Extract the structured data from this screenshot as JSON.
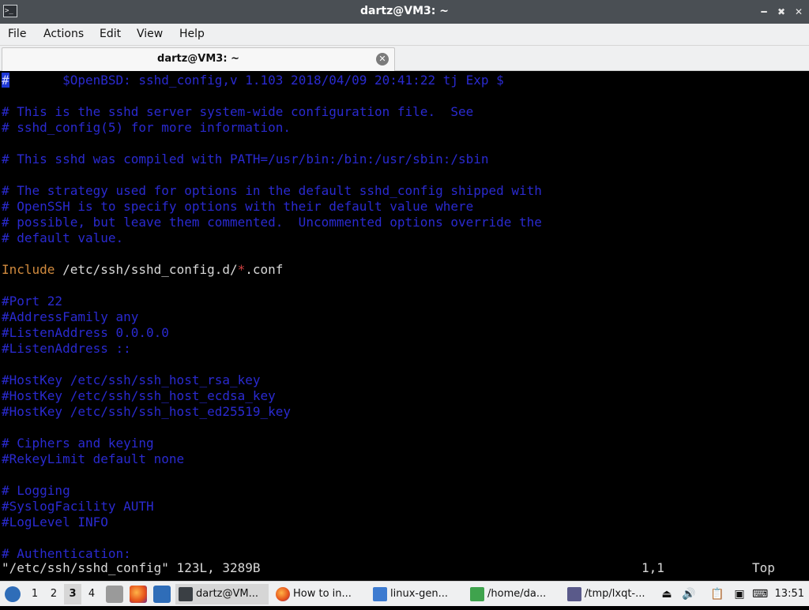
{
  "window": {
    "title": "dartz@VM3: ~",
    "app_icon": "terminal-icon",
    "buttons": [
      "minimize-icon",
      "maximize-icon",
      "close-icon"
    ]
  },
  "menu": [
    "File",
    "Actions",
    "Edit",
    "View",
    "Help"
  ],
  "tab": {
    "label": "dartz@VM3: ~"
  },
  "terminal": {
    "lines": [
      {
        "parts": [
          [
            "cursor",
            "#"
          ],
          [
            "c",
            "       $OpenBSD: sshd_config,v 1.103 2018/04/09 20:41:22 tj Exp $"
          ]
        ]
      },
      {
        "parts": []
      },
      {
        "parts": [
          [
            "c",
            "# This is the sshd server system-wide configuration file.  See"
          ]
        ]
      },
      {
        "parts": [
          [
            "c",
            "# sshd_config(5) for more information."
          ]
        ]
      },
      {
        "parts": []
      },
      {
        "parts": [
          [
            "c",
            "# This sshd was compiled with PATH=/usr/bin:/bin:/usr/sbin:/sbin"
          ]
        ]
      },
      {
        "parts": []
      },
      {
        "parts": [
          [
            "c",
            "# The strategy used for options in the default sshd_config shipped with"
          ]
        ]
      },
      {
        "parts": [
          [
            "c",
            "# OpenSSH is to specify options with their default value where"
          ]
        ]
      },
      {
        "parts": [
          [
            "c",
            "# possible, but leave them commented.  Uncommented options override the"
          ]
        ]
      },
      {
        "parts": [
          [
            "c",
            "# default value."
          ]
        ]
      },
      {
        "parts": []
      },
      {
        "parts": [
          [
            "k",
            "Include"
          ],
          [
            "n",
            " /etc/ssh/sshd_config.d/"
          ],
          [
            "s",
            "*"
          ],
          [
            "n",
            ".conf"
          ]
        ]
      },
      {
        "parts": []
      },
      {
        "parts": [
          [
            "c",
            "#Port 22"
          ]
        ]
      },
      {
        "parts": [
          [
            "c",
            "#AddressFamily any"
          ]
        ]
      },
      {
        "parts": [
          [
            "c",
            "#ListenAddress 0.0.0.0"
          ]
        ]
      },
      {
        "parts": [
          [
            "c",
            "#ListenAddress ::"
          ]
        ]
      },
      {
        "parts": []
      },
      {
        "parts": [
          [
            "c",
            "#HostKey /etc/ssh/ssh_host_rsa_key"
          ]
        ]
      },
      {
        "parts": [
          [
            "c",
            "#HostKey /etc/ssh/ssh_host_ecdsa_key"
          ]
        ]
      },
      {
        "parts": [
          [
            "c",
            "#HostKey /etc/ssh/ssh_host_ed25519_key"
          ]
        ]
      },
      {
        "parts": []
      },
      {
        "parts": [
          [
            "c",
            "# Ciphers and keying"
          ]
        ]
      },
      {
        "parts": [
          [
            "c",
            "#RekeyLimit default none"
          ]
        ]
      },
      {
        "parts": []
      },
      {
        "parts": [
          [
            "c",
            "# Logging"
          ]
        ]
      },
      {
        "parts": [
          [
            "c",
            "#SyslogFacility AUTH"
          ]
        ]
      },
      {
        "parts": [
          [
            "c",
            "#LogLevel INFO"
          ]
        ]
      },
      {
        "parts": []
      },
      {
        "parts": [
          [
            "c",
            "# Authentication:"
          ]
        ]
      }
    ],
    "status_file": "\"/etc/ssh/sshd_config\" 123L, 3289B",
    "status_pos": "1,1",
    "status_scroll": "Top"
  },
  "taskbar": {
    "menu_icon": "lxqt-menu-icon",
    "desktops": [
      "1",
      "2",
      "3",
      "4"
    ],
    "active_desktop": "3",
    "launchers": [
      "file-manager-icon",
      "firefox-icon",
      "show-desktop-icon"
    ],
    "tasks": [
      {
        "label": "dartz@VM...",
        "icon": "terminal-icon",
        "active": true
      },
      {
        "label": "How to in...",
        "icon": "firefox-icon",
        "active": false
      },
      {
        "label": "linux-gen...",
        "icon": "folder-icon",
        "active": false
      },
      {
        "label": "/home/da...",
        "icon": "text-editor-icon",
        "active": false
      },
      {
        "label": "/tmp/lxqt-...",
        "icon": "text-editor-icon",
        "active": false
      }
    ],
    "tray": [
      "eject-icon",
      "volume-icon",
      "clipboard-icon",
      "network-icon",
      "keyboard-layout-icon"
    ],
    "clock": "13:51"
  },
  "colors": {
    "comment": "#2a2ad0",
    "normal": "#d8d8d8",
    "keyword": "#d08a3e",
    "special": "#d04040",
    "titlebar": "#4a4f54",
    "panel": "#eff0f1"
  }
}
